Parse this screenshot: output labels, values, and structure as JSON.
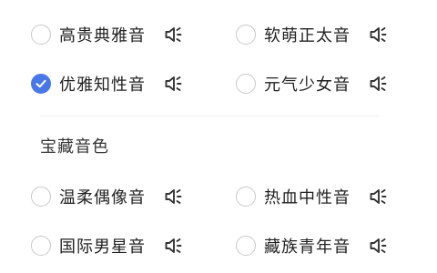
{
  "group_1": {
    "options": [
      {
        "label": "高贵典雅音",
        "checked": false
      },
      {
        "label": "软萌正太音",
        "checked": false
      },
      {
        "label": "优雅知性音",
        "checked": true
      },
      {
        "label": "元气少女音",
        "checked": false
      }
    ]
  },
  "group_2": {
    "title": "宝藏音色",
    "options": [
      {
        "label": "温柔偶像音",
        "checked": false
      },
      {
        "label": "热血中性音",
        "checked": false
      },
      {
        "label": "国际男星音",
        "checked": false
      },
      {
        "label": "藏族青年音",
        "checked": false
      }
    ]
  },
  "colors": {
    "accent": "#4a77e8",
    "radio_border": "#c8c8c8",
    "icon": "#333333"
  },
  "icons": {
    "selected": "check-icon",
    "preview": "speaker-icon"
  }
}
